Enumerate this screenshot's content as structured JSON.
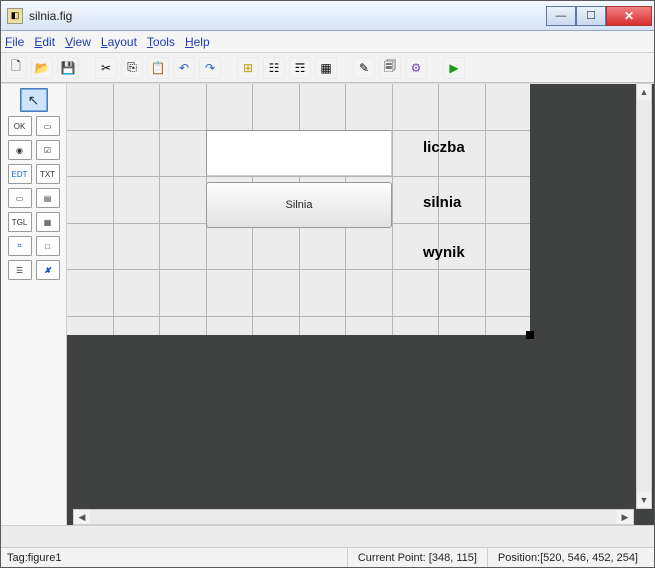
{
  "window": {
    "title": "silnia.fig"
  },
  "menu": {
    "file": "File",
    "edit": "Edit",
    "view": "View",
    "layout": "Layout",
    "tools": "Tools",
    "help": "Help"
  },
  "toolbar_icons": {
    "new": "🗋",
    "open": "📂",
    "save": "💾",
    "cut": "✂",
    "copy": "⎘",
    "paste": "📋",
    "undo": "↶",
    "redo": "↷",
    "align": "⊞",
    "menu_editor": "☷",
    "tab_order": "☶",
    "toolbar_editor": "▦",
    "editor": "✎",
    "property": "🗐",
    "object_browser": "⚙",
    "run": "▶"
  },
  "palette": {
    "select": "↖",
    "ok": "OK",
    "slider": "▭",
    "radio": "◉",
    "check": "☑",
    "edit": "EDT",
    "text": "TXT",
    "popup": "▭",
    "list": "▤",
    "toggle": "TGL",
    "table": "▦",
    "axes": "⌗",
    "panel": "□",
    "activex": "☰",
    "x": "✘"
  },
  "canvas": {
    "button_label": "Silnia",
    "label1": "liczba",
    "label2": "silnia",
    "label3": "wynik"
  },
  "status": {
    "tag_label": "Tag: ",
    "tag_value": "figure1",
    "current_point_label": "Current Point: ",
    "current_point_value": "[348, 115]",
    "position_label": "Position: ",
    "position_value": "[520, 546, 452, 254]"
  }
}
